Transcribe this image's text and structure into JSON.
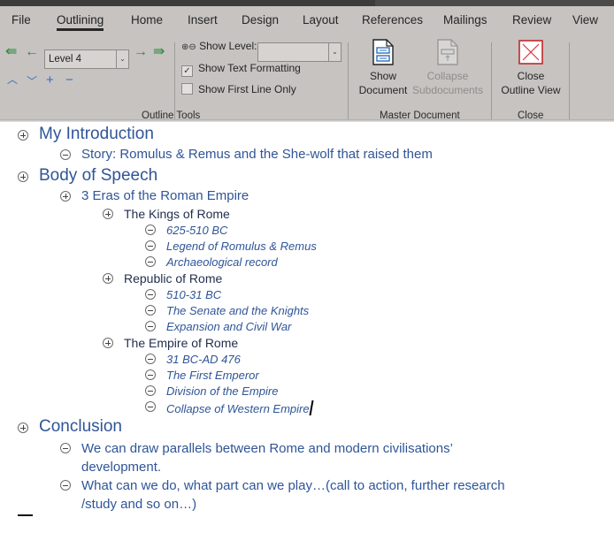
{
  "ribbon": {
    "tabs": [
      "File",
      "Outlining",
      "Home",
      "Insert",
      "Design",
      "Layout",
      "References",
      "Mailings",
      "Review",
      "View"
    ],
    "active_tab": "Outlining",
    "outline_tools": {
      "promote_to_heading1": "promote-to-heading-1-icon",
      "promote": "promote-icon",
      "level_value": "Level 4",
      "demote": "demote-icon",
      "demote_to_body": "demote-to-body-text-icon",
      "move_up": "move-up-icon",
      "move_down": "move-down-icon",
      "expand": "expand-icon",
      "collapse": "collapse-icon",
      "show_level_label": "Show Level:",
      "show_level_value": "",
      "show_text_formatting_label": "Show Text Formatting",
      "show_text_formatting_checked": true,
      "show_first_line_only_label": "Show First Line Only",
      "show_first_line_only_checked": false,
      "group_label": "Outline Tools"
    },
    "master_document": {
      "show_document_line1": "Show",
      "show_document_line2": "Document",
      "collapse_line1": "Collapse",
      "collapse_line2": "Subdocuments",
      "collapse_enabled": false,
      "group_label": "Master Document"
    },
    "close": {
      "close_line1": "Close",
      "close_line2": "Outline View",
      "group_label": "Close"
    }
  },
  "outline": [
    {
      "level": 1,
      "symbol": "plus",
      "text": "My Introduction"
    },
    {
      "level": 2,
      "symbol": "minus",
      "text": "Story: Romulus & Remus and the She-wolf that raised them"
    },
    {
      "level": 1,
      "symbol": "plus",
      "text": "Body of Speech"
    },
    {
      "level": 2,
      "symbol": "plus",
      "text": "3 Eras of the Roman Empire"
    },
    {
      "level": 3,
      "symbol": "plus",
      "text": "The Kings of Rome"
    },
    {
      "level": 4,
      "symbol": "minus",
      "text": "625-510 BC"
    },
    {
      "level": 4,
      "symbol": "minus",
      "text": "Legend of Romulus & Remus"
    },
    {
      "level": 4,
      "symbol": "minus",
      "text": "Archaeological record"
    },
    {
      "level": 3,
      "symbol": "plus",
      "text": "Republic of Rome"
    },
    {
      "level": 4,
      "symbol": "minus",
      "text": "510-31 BC"
    },
    {
      "level": 4,
      "symbol": "minus",
      "text": "The Senate and the Knights"
    },
    {
      "level": 4,
      "symbol": "minus",
      "text": "Expansion and Civil War"
    },
    {
      "level": 3,
      "symbol": "plus",
      "text": "The Empire of Rome"
    },
    {
      "level": 4,
      "symbol": "minus",
      "text": "31 BC-AD 476"
    },
    {
      "level": 4,
      "symbol": "minus",
      "text": "The First Emperor"
    },
    {
      "level": 4,
      "symbol": "minus",
      "text": "Division of the Empire"
    },
    {
      "level": 4,
      "symbol": "minus",
      "text": "Collapse of Western Empire"
    },
    {
      "level": 1,
      "symbol": "plus",
      "text": "Conclusion"
    },
    {
      "level": 2,
      "symbol": "minus",
      "text": "We can draw parallels between Rome and modern civilisations’",
      "continuation": "development."
    },
    {
      "level": 2,
      "symbol": "minus",
      "text": "What can we do, what part can we play…(call to action, further research",
      "continuation": "/study and so on…)"
    }
  ]
}
